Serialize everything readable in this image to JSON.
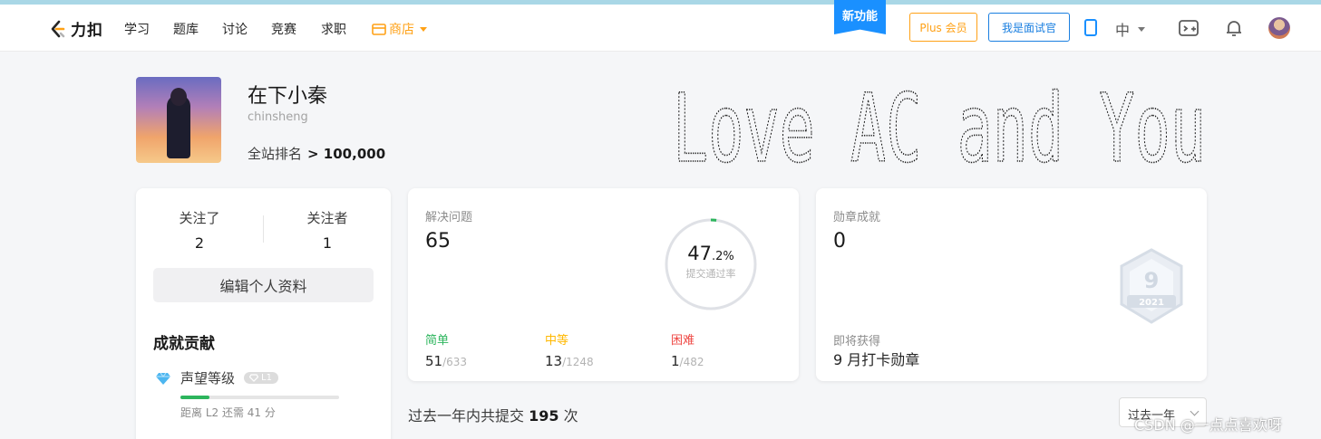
{
  "nav": {
    "logo_text": "力扣",
    "items": [
      "学习",
      "题库",
      "讨论",
      "竞赛",
      "求职"
    ],
    "shop": "商店",
    "new_feature": "新功能",
    "plus": "Plus 会员",
    "interviewer": "我是面试官",
    "lang": "中"
  },
  "profile": {
    "name": "在下小秦",
    "handle": "chinsheng",
    "rank_label": "全站排名",
    "rank_value": "> 100,000",
    "banner_text": "Love AC and You"
  },
  "follow": {
    "following_label": "关注了",
    "following_value": "2",
    "followers_label": "关注者",
    "followers_value": "1",
    "edit_label": "编辑个人资料"
  },
  "contribution": {
    "title": "成就贡献",
    "reputation_label": "声望等级",
    "level_badge": "L1",
    "progress_fraction": 0.18,
    "note": "距离 L2 还需 41 分"
  },
  "solved": {
    "label": "解决问题",
    "value": "65",
    "rate_int": "47",
    "rate_dec": ".2%",
    "rate_fraction": 0.02,
    "rate_label": "提交通过率",
    "easy_label": "简单",
    "easy_value": "51",
    "easy_total": "/633",
    "medium_label": "中等",
    "medium_value": "13",
    "medium_total": "/1248",
    "hard_label": "困难",
    "hard_value": "1",
    "hard_total": "/482",
    "colors": {
      "easy": "#2db55d",
      "medium": "#ffb800",
      "hard": "#ef4743"
    }
  },
  "badges": {
    "label": "勋章成就",
    "value": "0",
    "badge_number": "9",
    "badge_year": "2021",
    "upcoming_label": "即将获得",
    "upcoming_value": "9 月打卡勋章"
  },
  "submissions": {
    "prefix": "过去一年内共提交",
    "count": "195",
    "suffix": "次",
    "range_select": "过去一年"
  },
  "watermark": "CSDN @一点点喜欢呀"
}
